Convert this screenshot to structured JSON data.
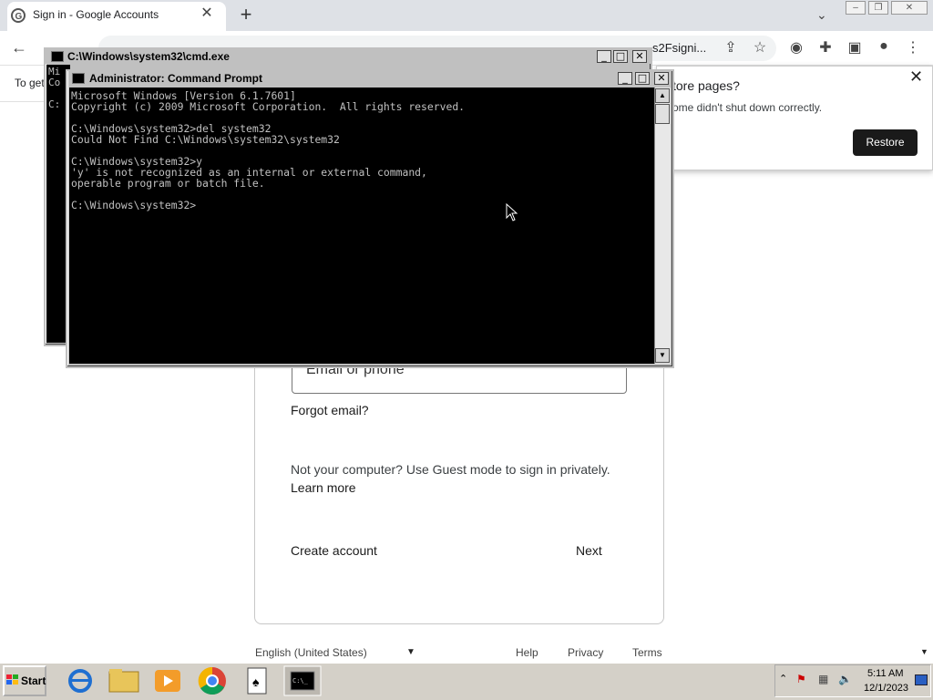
{
  "browser": {
    "tab_title": "Sign in - Google Accounts",
    "url_tail": "s2Fsigni...",
    "infobar_text": "To get"
  },
  "restore_bubble": {
    "title": "tore pages?",
    "body": "ome didn't shut down correctly.",
    "button": "Restore"
  },
  "signin": {
    "email_placeholder": "Email or phone",
    "forgot_email": "Forgot email?",
    "guest_text": "Not your computer? Use Guest mode to sign in privately.",
    "learn_more": "Learn more",
    "create_account": "Create account",
    "next": "Next"
  },
  "footer": {
    "language": "English (United States)",
    "help": "Help",
    "privacy": "Privacy",
    "terms": "Terms"
  },
  "cmd_back": {
    "title": "C:\\Windows\\system32\\cmd.exe",
    "fragment": "Mi\nCo\n\nC:"
  },
  "cmd_front": {
    "title": "Administrator: Command Prompt",
    "lines": "Microsoft Windows [Version 6.1.7601]\nCopyright (c) 2009 Microsoft Corporation.  All rights reserved.\n\nC:\\Windows\\system32>del system32\nCould Not Find C:\\Windows\\system32\\system32\n\nC:\\Windows\\system32>y\n'y' is not recognized as an internal or external command,\noperable program or batch file.\n\nC:\\Windows\\system32>"
  },
  "taskbar": {
    "start_label": "Start",
    "time": "5:11 AM",
    "date": "12/1/2023"
  },
  "colors": {
    "console_bg": "#000000",
    "console_fg": "#c0c0c0",
    "restore_button": "#1a1a1a",
    "taskbar": "#d4d0c8"
  },
  "icons": [
    "google-favicon",
    "back-icon",
    "share-icon",
    "star-icon",
    "extension-icon",
    "puzzle-icon",
    "sidepanel-icon",
    "profile-icon",
    "menu-icon",
    "cmd-icon",
    "cursor-icon",
    "ie-icon",
    "explorer-icon",
    "media-icon",
    "chrome-icon",
    "solitaire-icon",
    "cmd-taskbar-icon"
  ]
}
